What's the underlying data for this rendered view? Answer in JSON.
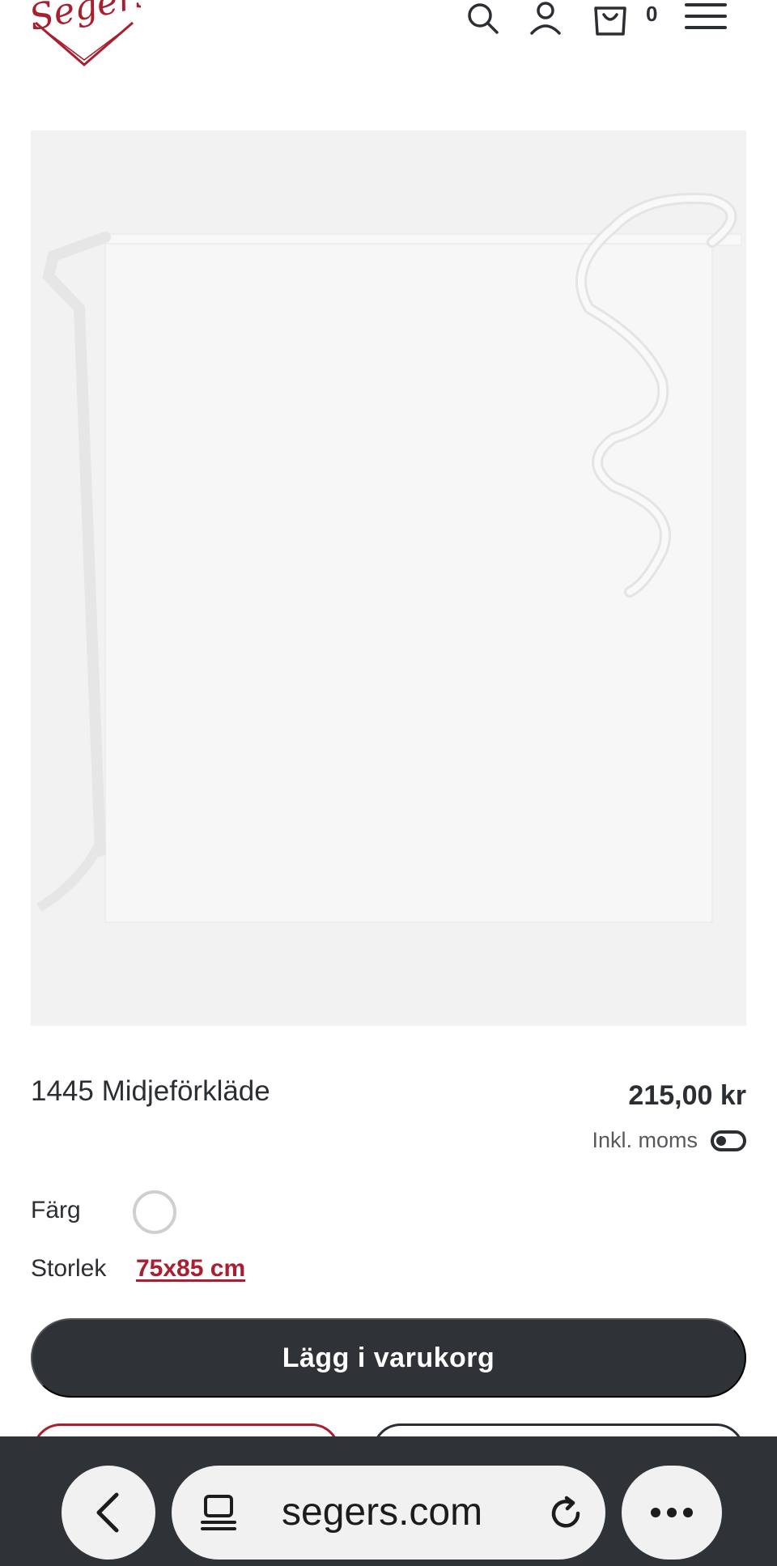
{
  "header": {
    "logo_text": "Segers",
    "cart_count": "0"
  },
  "product": {
    "title": "1445 Midjeförkläde",
    "price": "215,00 kr",
    "vat_label": "Inkl. moms",
    "color_label": "Färg",
    "size_label": "Storlek",
    "size_value": "75x85 cm",
    "add_to_cart_label": "Lägg i varukorg"
  },
  "browser": {
    "url": "segers.com"
  },
  "colors": {
    "brand_red": "#a8202f",
    "dark": "#2f3236",
    "image_bg": "#f2f2f2"
  },
  "icons": [
    "segers-logo",
    "search-icon",
    "user-icon",
    "cart-icon",
    "menu-icon",
    "toggle-icon",
    "back-icon",
    "tab-icon",
    "reload-icon",
    "more-icon"
  ]
}
